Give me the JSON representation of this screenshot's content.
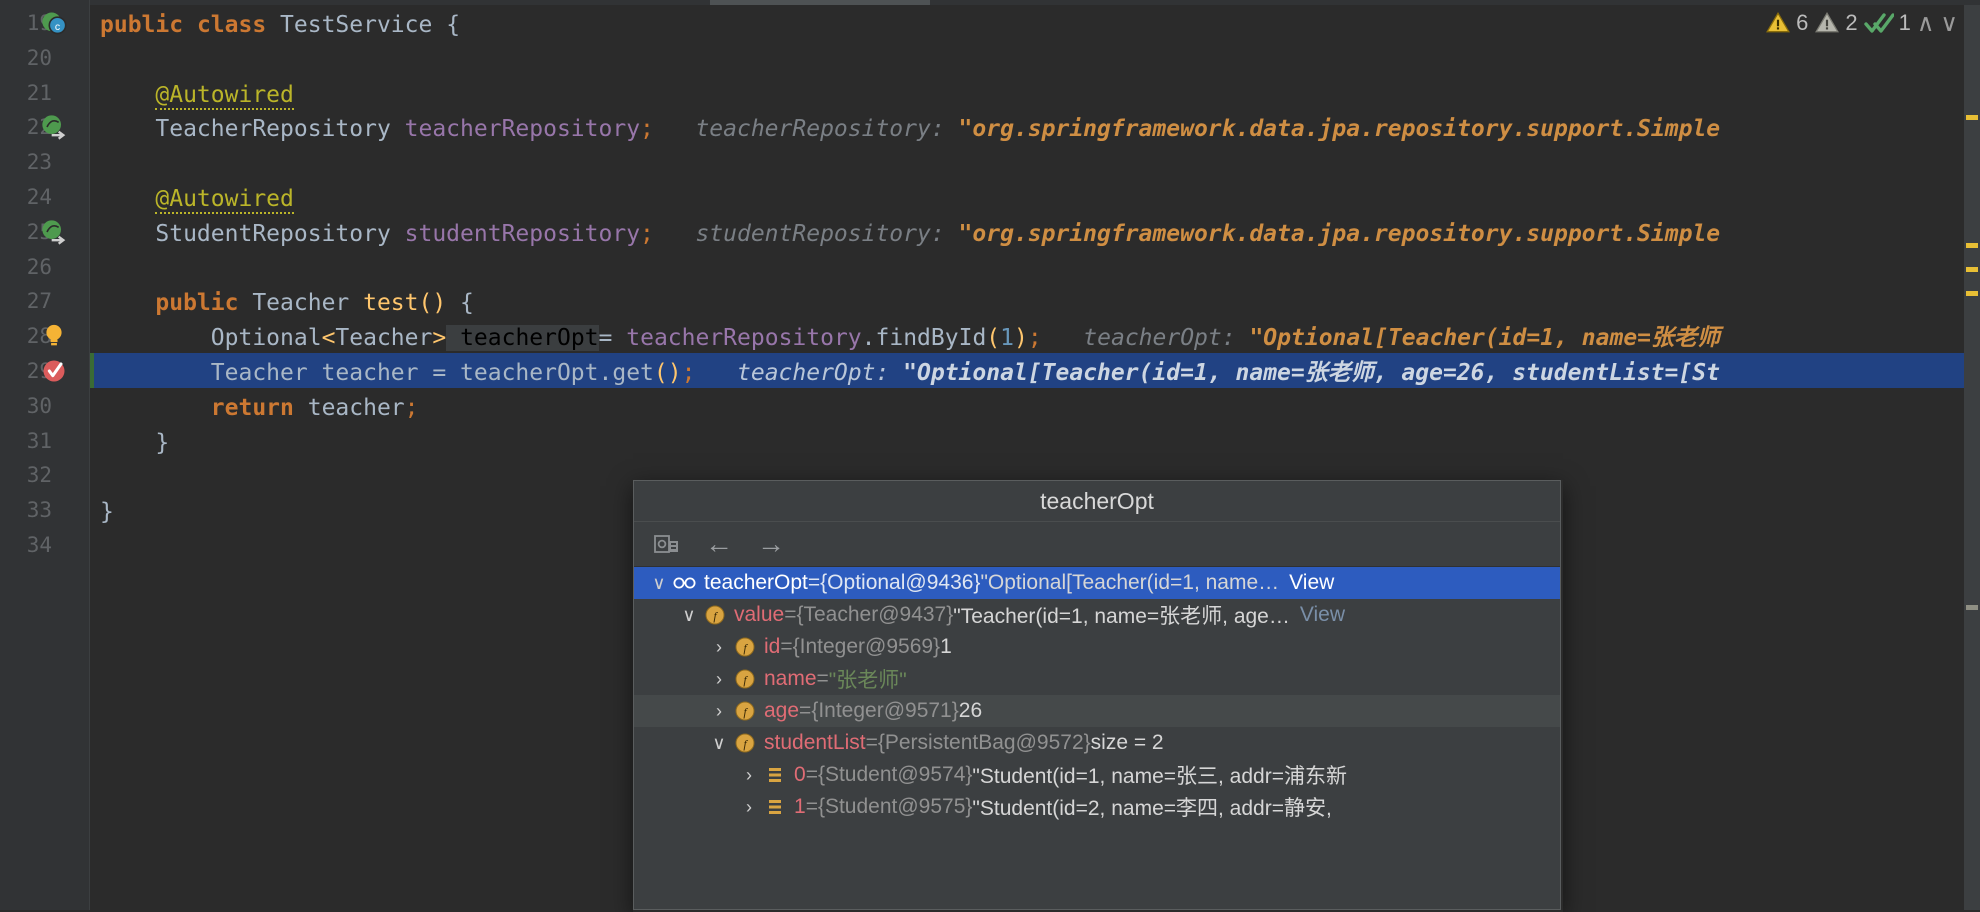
{
  "editor": {
    "first_line": 19,
    "lines": [
      {
        "n": 19,
        "gutter": "class-marker-icon",
        "segments": [
          {
            "t": "public ",
            "c": "kw"
          },
          {
            "t": "class ",
            "c": "kw"
          },
          {
            "t": "TestService ",
            "c": "cls"
          },
          {
            "t": "{",
            "c": "brace"
          }
        ],
        "indent": 0
      },
      {
        "n": 20,
        "gutter": "",
        "segments": [],
        "indent": 0
      },
      {
        "n": 21,
        "gutter": "",
        "segments": [
          {
            "t": "    ",
            "c": "plain"
          },
          {
            "t": "@Autowired",
            "c": "ann"
          }
        ],
        "indent": 0
      },
      {
        "n": 22,
        "gutter": "bean-navigate-icon",
        "segments": [
          {
            "t": "    ",
            "c": "plain"
          },
          {
            "t": "TeacherRepository ",
            "c": "cls"
          },
          {
            "t": "teacherRepository",
            "c": "fld"
          },
          {
            "t": ";",
            "c": "semi"
          },
          {
            "t": "   teacherRepository: ",
            "c": "hint"
          },
          {
            "t": "\"org.springframework.data.jpa.repository.support.Simple",
            "c": "hintstr"
          }
        ]
      },
      {
        "n": 23,
        "gutter": "",
        "segments": []
      },
      {
        "n": 24,
        "gutter": "",
        "segments": [
          {
            "t": "    ",
            "c": "plain"
          },
          {
            "t": "@Autowired",
            "c": "ann"
          }
        ]
      },
      {
        "n": 25,
        "gutter": "bean-navigate-icon",
        "segments": [
          {
            "t": "    ",
            "c": "plain"
          },
          {
            "t": "StudentRepository ",
            "c": "cls"
          },
          {
            "t": "studentRepository",
            "c": "fld"
          },
          {
            "t": ";",
            "c": "semi"
          },
          {
            "t": "   studentRepository: ",
            "c": "hint"
          },
          {
            "t": "\"org.springframework.data.jpa.repository.support.Simple",
            "c": "hintstr"
          }
        ]
      },
      {
        "n": 26,
        "gutter": "",
        "segments": []
      },
      {
        "n": 27,
        "gutter": "",
        "segments": [
          {
            "t": "    ",
            "c": "plain"
          },
          {
            "t": "public ",
            "c": "kw"
          },
          {
            "t": "Teacher ",
            "c": "cls"
          },
          {
            "t": "test",
            "c": "mth"
          },
          {
            "t": "()",
            "c": "paren"
          },
          {
            "t": " {",
            "c": "brace"
          }
        ]
      },
      {
        "n": 28,
        "gutter": "intention-bulb-icon",
        "segments": [
          {
            "t": "        ",
            "c": "plain"
          },
          {
            "t": "Optional",
            "c": "cls"
          },
          {
            "t": "<",
            "c": "generic"
          },
          {
            "t": "Teacher",
            "c": "cls"
          },
          {
            "t": ">",
            "c": "generic"
          },
          {
            "t": " teacherOpt",
            "c": "idhl"
          },
          {
            "t": "= ",
            "c": "plain"
          },
          {
            "t": "teacherRepository",
            "c": "fld"
          },
          {
            "t": ".",
            "c": "plain"
          },
          {
            "t": "findById",
            "c": "plain"
          },
          {
            "t": "(",
            "c": "paren"
          },
          {
            "t": "1",
            "c": "num"
          },
          {
            "t": ")",
            "c": "paren"
          },
          {
            "t": ";",
            "c": "semi"
          },
          {
            "t": "   teacherOpt: ",
            "c": "hint"
          },
          {
            "t": "\"Optional[Teacher(id=1, name=张老师",
            "c": "hintstr"
          }
        ]
      },
      {
        "n": 29,
        "gutter": "breakpoint-verified-icon",
        "selected": true,
        "segments": [
          {
            "t": "        ",
            "c": "plain"
          },
          {
            "t": "Teacher teacher = teacherOpt.get",
            "c": "plain"
          },
          {
            "t": "()",
            "c": "paren"
          },
          {
            "t": ";",
            "c": "semi"
          },
          {
            "t": "   teacherOpt: ",
            "c": "hint"
          },
          {
            "t": "\"Optional[Teacher(id=1, name=张老师, age=26, studentList=[St",
            "c": "hintstr"
          }
        ]
      },
      {
        "n": 30,
        "gutter": "",
        "segments": [
          {
            "t": "        ",
            "c": "plain"
          },
          {
            "t": "return ",
            "c": "kw"
          },
          {
            "t": "teacher",
            "c": "plain"
          },
          {
            "t": ";",
            "c": "semi"
          }
        ]
      },
      {
        "n": 31,
        "gutter": "",
        "segments": [
          {
            "t": "    ",
            "c": "plain"
          },
          {
            "t": "}",
            "c": "brace"
          }
        ]
      },
      {
        "n": 32,
        "gutter": "",
        "segments": []
      },
      {
        "n": 33,
        "gutter": "",
        "segments": [
          {
            "t": "}",
            "c": "brace"
          }
        ]
      },
      {
        "n": 34,
        "gutter": "",
        "segments": []
      }
    ]
  },
  "inspection_widget": {
    "warnings_label": "6",
    "weak_warnings_label": "2",
    "checks_label": "1",
    "prev_tooltip": "Previous highlighted error",
    "next_tooltip": "Next highlighted error",
    "up_chevron": "∧",
    "down_chevron": "∨",
    "warning_color": "#e8bf35",
    "weak_warning_color": "#a8a8a0",
    "ok_color": "#59a869"
  },
  "popup": {
    "title": "teacherOpt",
    "toolbar": {
      "set_value_icon": "set-value-icon",
      "back_label": "←",
      "forward_label": "→"
    },
    "tree": [
      {
        "depth": 0,
        "twist": "∨",
        "icon": "watch-glasses-icon",
        "selected": true,
        "name": "teacherOpt",
        "eq": " = ",
        "meta": "{Optional@9436}",
        "value": " \"Optional[Teacher(id=1, name…",
        "view": "View"
      },
      {
        "depth": 1,
        "twist": "∨",
        "icon": "field-icon",
        "name": "value",
        "eq": " = ",
        "meta": "{Teacher@9437}",
        "value": " \"Teacher(id=1, name=张老师, age…",
        "view": "View"
      },
      {
        "depth": 2,
        "twist": "›",
        "icon": "field-icon",
        "name": "id",
        "eq": " = ",
        "meta": "{Integer@9569}",
        "value": " 1",
        "view": ""
      },
      {
        "depth": 2,
        "twist": "›",
        "icon": "field-icon",
        "name": "name",
        "eq": " = ",
        "meta": "",
        "value": "\"张老师\"",
        "value_kind": "string",
        "view": ""
      },
      {
        "depth": 2,
        "twist": "›",
        "icon": "field-icon",
        "hover": true,
        "name": "age",
        "eq": " = ",
        "meta": "{Integer@9571}",
        "value": " 26",
        "view": ""
      },
      {
        "depth": 2,
        "twist": "∨",
        "icon": "field-icon",
        "name": "studentList",
        "eq": " = ",
        "meta": "{PersistentBag@9572}",
        "value": "  size = 2",
        "view": ""
      },
      {
        "depth": 3,
        "twist": "›",
        "icon": "array-element-icon",
        "name": "0",
        "eq": " = ",
        "meta": "{Student@9574}",
        "value": " \"Student(id=1, name=张三, addr=浦东新",
        "view": ""
      },
      {
        "depth": 3,
        "twist": "›",
        "icon": "array-element-icon",
        "name": "1",
        "eq": " = ",
        "meta": "{Student@9575}",
        "value": " \"Student(id=2, name=李四, addr=静安,",
        "view": ""
      }
    ]
  },
  "colors": {
    "editor_bg": "#2b2b2b",
    "gutter_bg": "#313335",
    "selection_blue": "#214283",
    "popup_bg": "#3c3f41",
    "tree_selection": "#2d5cbf",
    "keyword": "#cc7832",
    "field": "#9876aa",
    "method": "#ffc66d",
    "string": "#6a8759",
    "hint_string": "#cf8e43"
  }
}
